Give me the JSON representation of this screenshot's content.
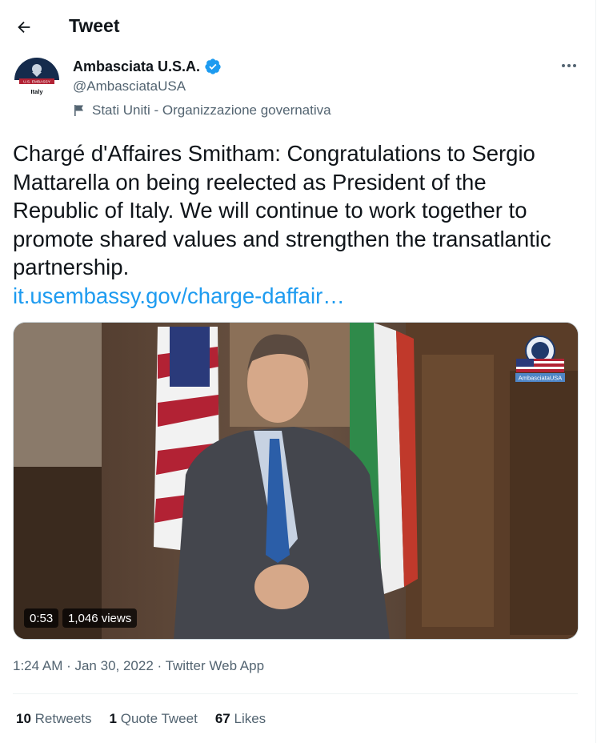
{
  "header": {
    "title": "Tweet"
  },
  "author": {
    "name": "Ambasciata U.S.A.",
    "handle": "@AmbasciataUSA",
    "label": "Stati Uniti - Organizzazione governativa",
    "avatar_text_top": "U.S. EMBASSY",
    "avatar_text_bottom": "Italy"
  },
  "tweet": {
    "text": "Chargé d'Affaires Smitham: Congratulations to Sergio Mattarella on being reelected as President of the Republic of Italy. We will continue to work together to promote shared values and strengthen the transatlantic partnership.",
    "link": "it.usembassy.gov/charge-daffair…"
  },
  "video": {
    "duration": "0:53",
    "views": "1,046 views",
    "badge_text": "AmbasciataUSA"
  },
  "meta": {
    "timestamp": "1:24 AM · Jan 30, 2022 · Twitter Web App"
  },
  "stats": {
    "retweets_count": "10",
    "retweets_label": "Retweets",
    "quotes_count": "1",
    "quotes_label": "Quote Tweet",
    "likes_count": "67",
    "likes_label": "Likes"
  },
  "colors": {
    "link": "#1d9bf0",
    "verified": "#1d9bf0",
    "secondary_text": "#536471"
  },
  "icons": [
    "back-arrow-icon",
    "verified-badge-icon",
    "flag-icon",
    "more-icon",
    "embassy-seal-icon"
  ]
}
